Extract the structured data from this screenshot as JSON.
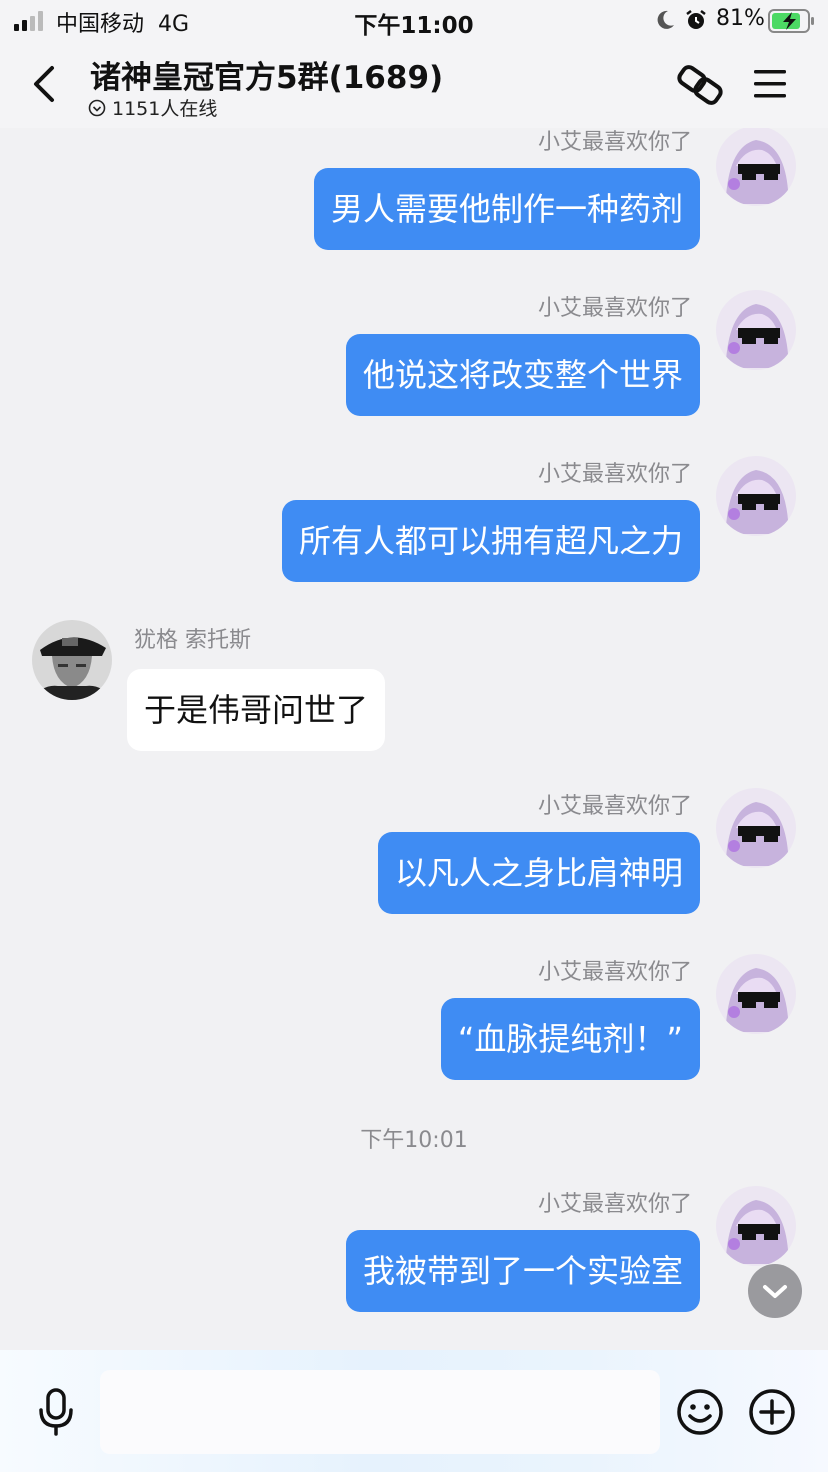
{
  "status_bar": {
    "carrier": "中国移动",
    "network": "4G",
    "time": "下午11:00",
    "battery_percent": "81%"
  },
  "nav": {
    "title": "诸神皇冠官方5群(1689)",
    "online": "1151人在线"
  },
  "messages": [
    {
      "sender": "小艾最喜欢你了",
      "text": "男人需要他制作一种药剂",
      "mine": true
    },
    {
      "sender": "小艾最喜欢你了",
      "text": "他说这将改变整个世界",
      "mine": true
    },
    {
      "sender": "小艾最喜欢你了",
      "text": "所有人都可以拥有超凡之力",
      "mine": true
    },
    {
      "sender": "犹格 索托斯",
      "text": "于是伟哥问世了",
      "mine": false
    },
    {
      "sender": "小艾最喜欢你了",
      "text": "以凡人之身比肩神明",
      "mine": true
    },
    {
      "sender": "小艾最喜欢你了",
      "text": "“血脉提纯剂！”",
      "mine": true
    },
    {
      "sender": "小艾最喜欢你了",
      "text": "我被带到了一个实验室",
      "mine": true
    }
  ],
  "timestamp": "下午10:01",
  "input": {
    "placeholder": ""
  },
  "colors": {
    "accent": "#3f8cf3",
    "background": "#f1f1f3"
  }
}
